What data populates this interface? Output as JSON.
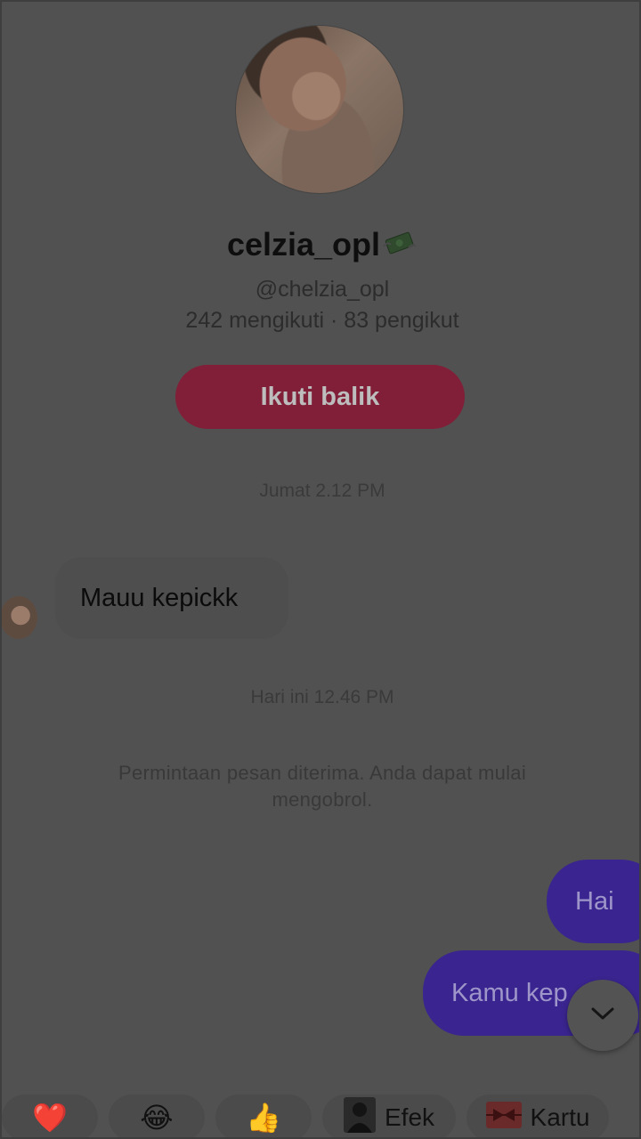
{
  "profile": {
    "display_name": "celzia_opl",
    "username": "@chelzia_opl",
    "stats": "242 mengikuti · 83 pengikut",
    "follow_back_label": "Ikuti balik"
  },
  "messages": {
    "timestamp_1": "Jumat 2.12 PM",
    "incoming_1": "Mauu kepickk",
    "timestamp_2": "Hari ini 12.46 PM",
    "system_notice": "Permintaan pesan diterima. Anda dapat mulai mengobrol.",
    "outgoing_1": "Hai",
    "outgoing_2": "Kamu kep"
  },
  "quick_reactions": {
    "heart": "❤️",
    "laugh": "😂",
    "thumbs_up": "👍",
    "effects_label": "Efek",
    "card_label": "Kartu"
  },
  "icons": {
    "name_badge": "money-with-wings-icon",
    "scroll_down": "chevron-down-icon",
    "effects": "effects-thumbnail-icon",
    "card": "gift-card-icon"
  },
  "colors": {
    "follow_button": "#811f38",
    "outgoing_bubble": "#3a2590",
    "overlay_background": "#515151"
  }
}
